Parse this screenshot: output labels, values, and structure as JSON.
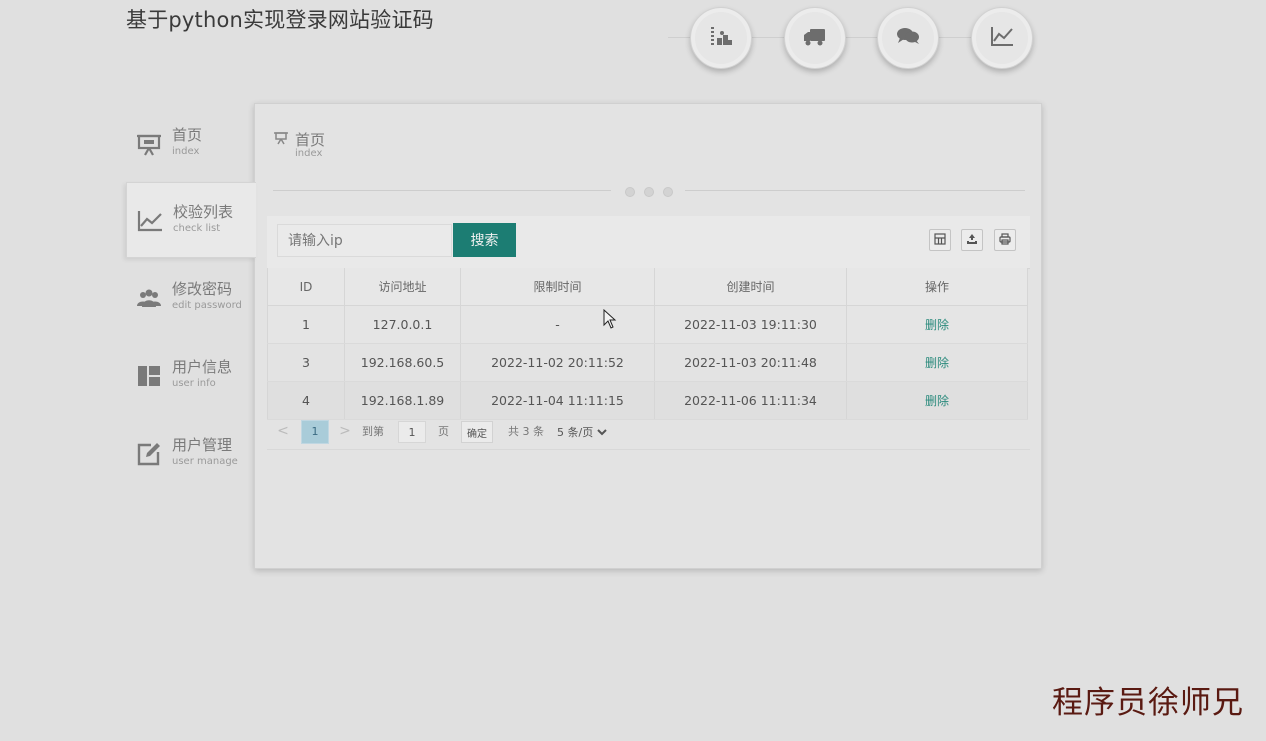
{
  "header": {
    "title": "基于python实现登录网站验证码",
    "icons": [
      "stats-icon",
      "truck-icon",
      "chat-icon",
      "line-chart-icon"
    ]
  },
  "sidebar": {
    "items": [
      {
        "label": "首页",
        "sub": "index",
        "icon": "presentation-icon",
        "active": false
      },
      {
        "label": "校验列表",
        "sub": "check list",
        "icon": "line-chart-icon",
        "active": true
      },
      {
        "label": "修改密码",
        "sub": "edit password",
        "icon": "users-icon",
        "active": false
      },
      {
        "label": "用户信息",
        "sub": "user info",
        "icon": "layout-icon",
        "active": false
      },
      {
        "label": "用户管理",
        "sub": "user manage",
        "icon": "edit-icon",
        "active": false
      }
    ]
  },
  "panel": {
    "title": "首页",
    "sub": "index"
  },
  "search": {
    "placeholder": "请输入ip",
    "value": "",
    "button": "搜索"
  },
  "toolbar_icons": [
    "columns-icon",
    "export-icon",
    "print-icon"
  ],
  "table": {
    "headers": [
      "ID",
      "访问地址",
      "限制时间",
      "创建时间",
      "操作"
    ],
    "rows": [
      {
        "id": "1",
        "ip": "127.0.0.1",
        "limit": "-",
        "created": "2022-11-03 19:11:30",
        "action": "删除"
      },
      {
        "id": "3",
        "ip": "192.168.60.5",
        "limit": "2022-11-02 20:11:52",
        "created": "2022-11-03 20:11:48",
        "action": "删除"
      },
      {
        "id": "4",
        "ip": "192.168.1.89",
        "limit": "2022-11-04 11:11:15",
        "created": "2022-11-06 11:11:34",
        "action": "删除"
      }
    ]
  },
  "pager": {
    "prev": "<",
    "current": "1",
    "next": ">",
    "goto_label": "到第",
    "goto_value": "1",
    "page_unit": "页",
    "confirm": "确定",
    "total": "共 3 条",
    "page_size": "5 条/页"
  },
  "watermark": "程序员徐师兄",
  "colors": {
    "primary": "#1c7d73",
    "link": "#2a8a7c",
    "page_bg": "#e0e0e0",
    "current_page": "#a9ccd9"
  }
}
